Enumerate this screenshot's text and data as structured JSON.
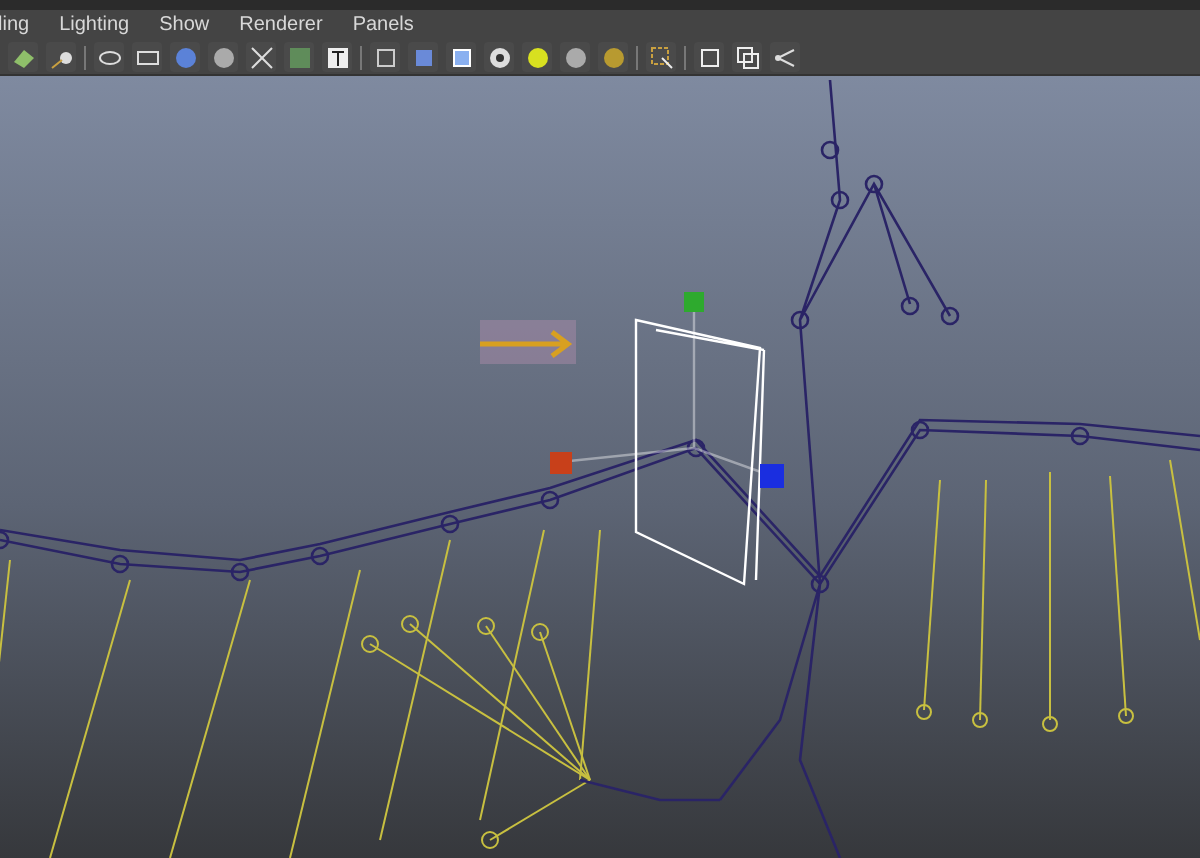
{
  "menu": [
    {
      "label": "ling"
    },
    {
      "label": "Lighting"
    },
    {
      "label": "Show"
    },
    {
      "label": "Renderer"
    },
    {
      "label": "Panels"
    }
  ]
}
